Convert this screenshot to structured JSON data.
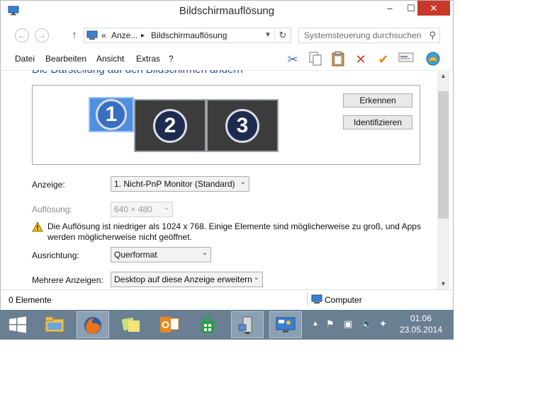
{
  "window": {
    "title": "Bildschirmauflösung",
    "controls": {
      "minimize": "–",
      "maximize": "☐",
      "close": "✕"
    }
  },
  "address": {
    "crumb_prefix": "«",
    "crumb_1": "Anze...",
    "crumb_sep": "▸",
    "crumb_2": "Bildschirmauflösung",
    "search_placeholder": "Systemsteuerung durchsuchen"
  },
  "menu": {
    "items": [
      "Datei",
      "Bearbeiten",
      "Ansicht",
      "Extras",
      "?"
    ]
  },
  "toolbar_icons": [
    "scissors-icon",
    "copy-icon",
    "paste-icon",
    "delete-icon",
    "checkmark-icon",
    "properties-icon",
    "shell-icon"
  ],
  "content": {
    "heading": "Die Darstellung auf den Bildschirmen ändern",
    "monitors": [
      {
        "number": "1",
        "selected": true
      },
      {
        "number": "2",
        "selected": false
      },
      {
        "number": "3",
        "selected": false
      }
    ],
    "detect_button": "Erkennen",
    "identify_button": "Identifizieren",
    "display_label": "Anzeige:",
    "display_value": "1. Nicht-PnP Monitor (Standard)",
    "resolution_label": "Auflösung:",
    "resolution_value": "640 × 480",
    "warning_line1": "Die Auflösung ist niedriger als 1024 x 768. Einige Elemente sind möglicherweise zu groß, und Apps",
    "warning_line2": "werden möglicherweise nicht geöffnet.",
    "orientation_label": "Ausrichtung:",
    "orientation_value": "Querformat",
    "multi_label": "Mehrere Anzeigen:",
    "multi_value": "Desktop auf diese Anzeige erweitern"
  },
  "status": {
    "items": "0 Elemente",
    "location": "Computer"
  },
  "taskbar": {
    "apps": [
      "windows-start-icon",
      "file-explorer-icon",
      "firefox-icon",
      "sticky-notes-icon",
      "outlook-icon",
      "store-icon",
      "network-icon",
      "control-panel-icon"
    ],
    "clock_time": "01:06",
    "clock_date": "23.05.2014"
  },
  "colors": {
    "accent_blue": "#1e4d91",
    "close_red": "#c7372a",
    "taskbar": "#6b7f93"
  }
}
